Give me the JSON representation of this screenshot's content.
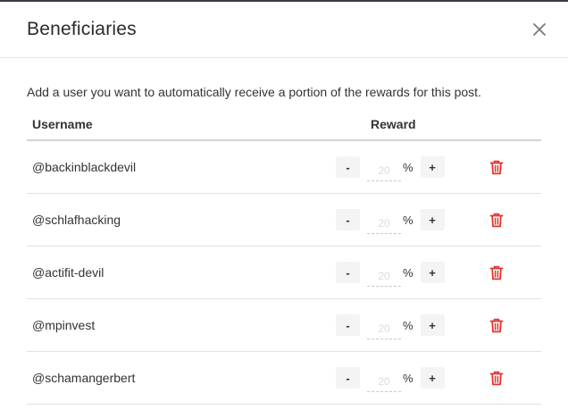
{
  "dialog": {
    "title": "Beneficiaries",
    "description": "Add a user you want to automatically receive a portion of the rewards for this post.",
    "close_icon": "close-icon"
  },
  "table": {
    "columns": {
      "username": "Username",
      "reward": "Reward"
    },
    "rows": [
      {
        "username": "@backinblackdevil",
        "percent": "20",
        "pct_sign": "%",
        "minus": "-",
        "plus": "+"
      },
      {
        "username": "@schlafhacking",
        "percent": "20",
        "pct_sign": "%",
        "minus": "-",
        "plus": "+"
      },
      {
        "username": "@actifit-devil",
        "percent": "20",
        "pct_sign": "%",
        "minus": "-",
        "plus": "+"
      },
      {
        "username": "@mpinvest",
        "percent": "20",
        "pct_sign": "%",
        "minus": "-",
        "plus": "+"
      },
      {
        "username": "@schamangerbert",
        "percent": "20",
        "pct_sign": "%",
        "minus": "-",
        "plus": "+"
      }
    ]
  },
  "colors": {
    "delete_icon": "#e3342f",
    "header_border": "#3a3f47"
  }
}
